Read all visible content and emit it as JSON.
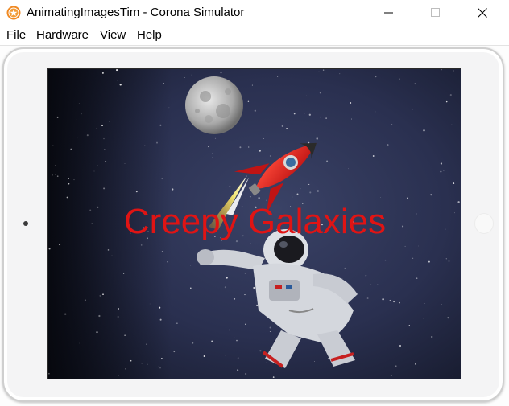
{
  "window": {
    "title": "AnimatingImagesTim - Corona Simulator",
    "app_icon": "corona-star-icon",
    "controls": [
      "minimize-icon",
      "maximize-icon",
      "close-icon"
    ]
  },
  "menu": {
    "items": [
      {
        "label": "File"
      },
      {
        "label": "Hardware"
      },
      {
        "label": "View"
      },
      {
        "label": "Help"
      }
    ]
  },
  "app_screen": {
    "headline": "Creepy Galaxies",
    "headline_color": "#e01414",
    "background": "starry-space",
    "images": [
      "moon",
      "rocket",
      "astronaut"
    ]
  },
  "colors": {
    "space": "#2b3152",
    "rocket": "#d81c1c",
    "flame": "#ffd23a"
  }
}
